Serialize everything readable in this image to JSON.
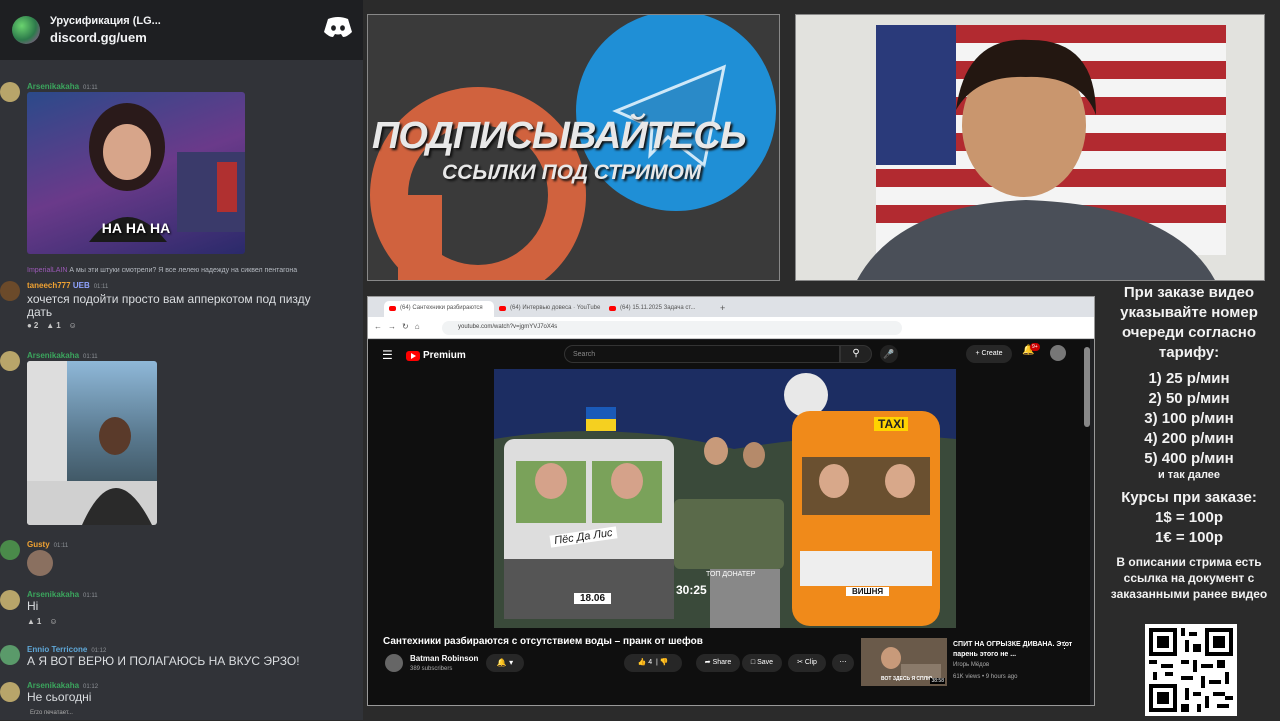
{
  "discord": {
    "server_name": "Урусификация (LG...",
    "invite": "discord.gg/uem",
    "messages": [
      {
        "user": "Arsenikakaha",
        "time": "01:11",
        "media_caption": "НА НА НА"
      },
      {
        "reply_user": "ImperialLAIN",
        "reply_text": "А мы эти штуки смотрели? Я все лелею надежду на сиквел пентагона",
        "user": "taneech777",
        "badge": "UEB",
        "time": "01:11",
        "text": "хочется подойти просто вам апперкотом под пизду",
        "text2": "дать",
        "reactions": [
          "2",
          "1"
        ]
      },
      {
        "user": "Arsenikakaha",
        "time": "01:11"
      },
      {
        "user": "Gusty",
        "time": "01:11"
      },
      {
        "user": "Arsenikakaha",
        "time": "01:11",
        "text": "Hi",
        "reactions": [
          "1"
        ]
      },
      {
        "user": "Ennio Terricone",
        "time": "01:12",
        "text": "А Я ВОТ ВЕРЮ И ПОЛАГАЮСЬ НА ВКУС ЭРЗО!"
      },
      {
        "user": "Arsenikakaha",
        "time": "01:12",
        "text": "Не сьогодні"
      }
    ],
    "typing": "Erzo печатает..."
  },
  "promo": {
    "line1": "ПОДПИСЫВАЙТЕСЬ",
    "line2": "ССЫЛКИ ПОД СТРИМОМ"
  },
  "browser": {
    "tabs": [
      "(64) Сантехники разбираются",
      "(64) Интервью довеса · YouTube",
      "(64) 15.11.2025 Задача ст..."
    ],
    "url": "youtube.com/watch?v=jgmYVJ7oX4s"
  },
  "youtube": {
    "brand": "Premium",
    "search_placeholder": "Search",
    "create": "+ Create",
    "notif_count": "9+",
    "video_title": "Сантехники разбираются с отсутствием воды – пранк от шефов",
    "channel": "Batman Robinson",
    "subs": "389 subscribers",
    "likes": "4",
    "share": "Share",
    "save": "Save",
    "clip": "Clip",
    "thumb_plate1": "Пёс Да Лис",
    "thumb_number": "18.06",
    "thumb_timer": "30:25",
    "thumb_top": "ТОП ДОНАТЕР",
    "thumb_taxi": "TAXI",
    "thumb_plate2": "ВИШНЯ",
    "rec_title": "СПИТ НА ОГРЫЗКЕ ДИВАНА. Этот парень этого не ...",
    "rec_channel": "Игорь Мёдов",
    "rec_views": "61K views • 9 hours ago",
    "rec_duration": "38:58",
    "rec_caption": "ВОТ ЗДЕСЬ Я СПЛЮ"
  },
  "info": {
    "heading": "При заказе видео указывайте номер очереди согласно тарифу:",
    "prices": [
      "1) 25 р/мин",
      "2) 50 р/мин",
      "3) 100 р/мин",
      "4) 200 р/мин",
      "5) 400 р/мин"
    ],
    "etc": "и так далее",
    "courses_title": "Курсы при заказе:",
    "course1": "1$ = 100р",
    "course2": "1€ = 100р",
    "desc": "В описании стрима есть ссылка на документ с заказанными ранее видео"
  },
  "colors": {
    "discord_bg": "#313338",
    "username_green": "#3ba55d",
    "username_orange": "#f0a232",
    "yt_red": "#ff0000"
  }
}
